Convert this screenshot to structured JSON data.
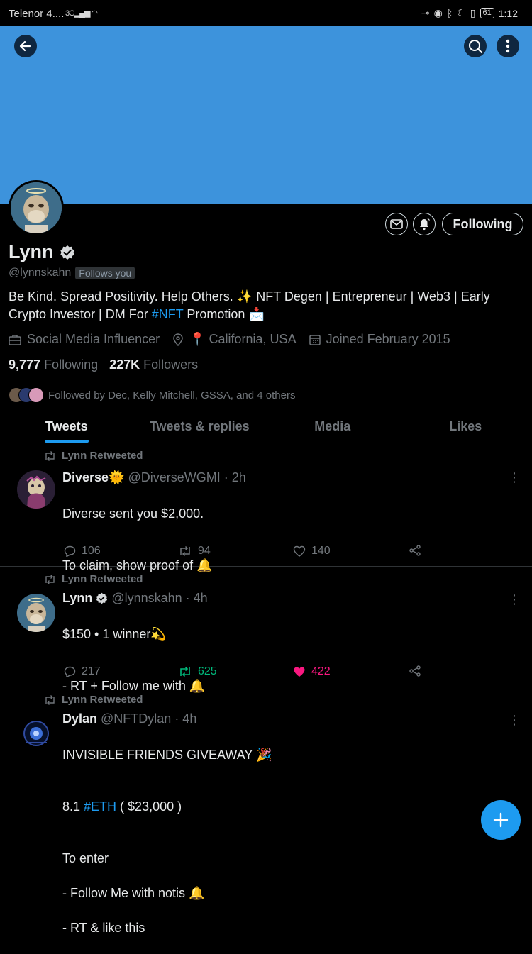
{
  "status_bar": {
    "carrier": "Telenor 4....",
    "network": "3G",
    "time": "1:12",
    "battery": "61"
  },
  "profile": {
    "name": "Lynn",
    "handle": "@lynnskahn",
    "follows_you": "Follows you",
    "follow_button": "Following",
    "bio_part1": "Be Kind. Spread Positivity. Help Others. ✨ NFT Degen | Entrepreneur | Web3 | Early Crypto Investor | DM For ",
    "bio_hashtag": "#NFT",
    "bio_part2": " Promotion 📩",
    "category": "Social Media Influencer",
    "location": "📍 California, USA",
    "joined": "Joined February 2015",
    "following_count": "9,777",
    "following_label": "Following",
    "followers_count": "227K",
    "followers_label": "Followers",
    "followed_by": "Followed by Dec, Kelly Mitchell, GSSA, and 4 others"
  },
  "tabs": [
    "Tweets",
    "Tweets & replies",
    "Media",
    "Likes"
  ],
  "tweets": [
    {
      "retweeted_by": "Lynn Retweeted",
      "name": "Diverse🌞",
      "handle": "@DiverseWGMI",
      "time": "· 2h",
      "line1": "Diverse sent you $2,000.",
      "line2": "To claim, show proof of 🔔",
      "replies": "106",
      "retweets": "94",
      "likes": "140"
    },
    {
      "retweeted_by": "Lynn Retweeted",
      "name": "Lynn",
      "handle": "@lynnskahn",
      "time": "· 4h",
      "line1": "$150 • 1 winner💫",
      "line2": "- RT + Follow me with 🔔",
      "replies": "217",
      "retweets": "625",
      "likes": "422"
    },
    {
      "retweeted_by": "Lynn Retweeted",
      "name": "Dylan",
      "handle": "@NFTDylan",
      "time": "· 4h",
      "line1": "INVISIBLE FRIENDS GIVEAWAY 🎉",
      "line2_a": " 8.1 ",
      "line2_tag": "#ETH",
      "line2_b": " ( $23,000 )",
      "line3": "To enter",
      "line4": "- Follow Me with notis 🔔",
      "line5": "- RT & like this"
    }
  ],
  "colors": {
    "banner": "#3d93dc",
    "accent": "#1d9bf0",
    "retweet_active": "#00ba7c",
    "like_active": "#f91880"
  }
}
